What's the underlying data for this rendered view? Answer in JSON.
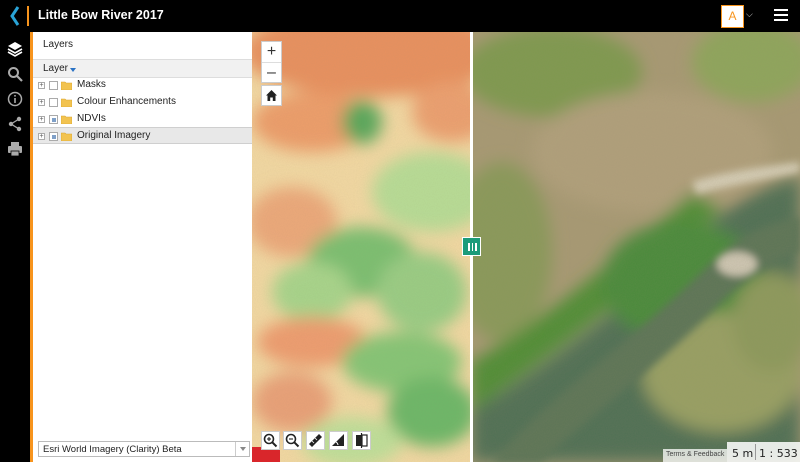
{
  "app": {
    "title": "Little Bow River 2017",
    "user_initial": "A",
    "accent_color": "#f7941d"
  },
  "rail": {
    "icons": [
      "layers-icon",
      "search-icon",
      "info-icon",
      "share-icon",
      "print-icon"
    ]
  },
  "layers_panel": {
    "title": "Layers",
    "header_label": "Layer",
    "items": [
      {
        "label": "Masks",
        "checked": "unchecked",
        "selected": false
      },
      {
        "label": "Colour Enhancements",
        "checked": "unchecked",
        "selected": false
      },
      {
        "label": "NDVIs",
        "checked": "partial",
        "selected": false
      },
      {
        "label": "Original Imagery",
        "checked": "partial",
        "selected": true
      }
    ],
    "basemap": "Esri World Imagery (Clarity) Beta"
  },
  "map": {
    "zoom_in": "+",
    "zoom_out": "–",
    "attribution": "Terms & Feedback",
    "scale_distance": "5 m",
    "scale_ratio": "1 : 533",
    "tools": [
      "zoom-in-tool-icon",
      "zoom-out-tool-icon",
      "measure-icon",
      "area-icon",
      "swipe-icon"
    ]
  }
}
